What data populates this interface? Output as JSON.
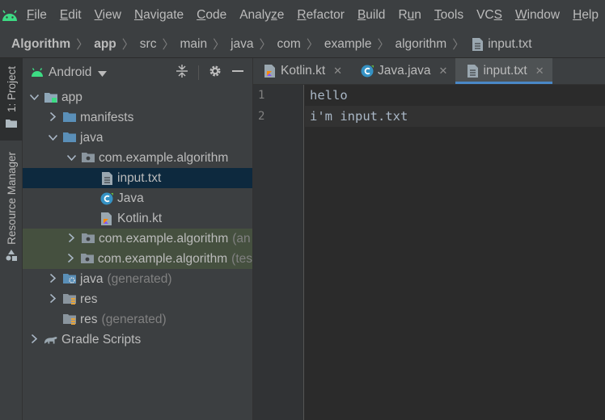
{
  "menu": {
    "items": [
      {
        "pre": "",
        "u": "F",
        "post": "ile"
      },
      {
        "pre": "",
        "u": "E",
        "post": "dit"
      },
      {
        "pre": "",
        "u": "V",
        "post": "iew"
      },
      {
        "pre": "",
        "u": "N",
        "post": "avigate"
      },
      {
        "pre": "",
        "u": "C",
        "post": "ode"
      },
      {
        "pre": "Analy",
        "u": "z",
        "post": "e"
      },
      {
        "pre": "",
        "u": "R",
        "post": "efactor"
      },
      {
        "pre": "",
        "u": "B",
        "post": "uild"
      },
      {
        "pre": "R",
        "u": "u",
        "post": "n"
      },
      {
        "pre": "",
        "u": "T",
        "post": "ools"
      },
      {
        "pre": "VC",
        "u": "S",
        "post": ""
      },
      {
        "pre": "",
        "u": "W",
        "post": "indow"
      },
      {
        "pre": "",
        "u": "H",
        "post": "elp"
      }
    ]
  },
  "breadcrumb": [
    "Algorithm",
    "app",
    "src",
    "main",
    "java",
    "com",
    "example",
    "algorithm",
    "input.txt"
  ],
  "toolstrip": {
    "project_tab": "1: Project",
    "resource_tab": "Resource Manager"
  },
  "project": {
    "view": "Android",
    "tree": [
      {
        "label": "app",
        "muted": "",
        "arrow": "down",
        "icon": "module-folder-icon",
        "depth": 0,
        "state": ""
      },
      {
        "label": "manifests",
        "muted": "",
        "arrow": "right",
        "icon": "folder-icon",
        "depth": 1,
        "state": ""
      },
      {
        "label": "java",
        "muted": "",
        "arrow": "down",
        "icon": "folder-icon",
        "depth": 1,
        "state": ""
      },
      {
        "label": "com.example.algorithm",
        "muted": "",
        "arrow": "down",
        "icon": "package-icon",
        "depth": 2,
        "state": ""
      },
      {
        "label": "input.txt",
        "muted": "",
        "arrow": "",
        "icon": "text-file-icon",
        "depth": 3,
        "state": "selected"
      },
      {
        "label": "Java",
        "muted": "",
        "arrow": "",
        "icon": "java-class-icon",
        "depth": 3,
        "state": ""
      },
      {
        "label": "Kotlin.kt",
        "muted": "",
        "arrow": "",
        "icon": "kotlin-file-icon",
        "depth": 3,
        "state": ""
      },
      {
        "label": "com.example.algorithm",
        "muted": "(an",
        "arrow": "right",
        "icon": "package-icon",
        "depth": 2,
        "state": "test"
      },
      {
        "label": "com.example.algorithm",
        "muted": "(tes",
        "arrow": "right",
        "icon": "package-icon",
        "depth": 2,
        "state": "test"
      },
      {
        "label": "java",
        "muted": "(generated)",
        "arrow": "right",
        "icon": "generated-folder-icon",
        "depth": 1,
        "state": ""
      },
      {
        "label": "res",
        "muted": "",
        "arrow": "right",
        "icon": "resource-folder-icon",
        "depth": 1,
        "state": ""
      },
      {
        "label": "res",
        "muted": "(generated)",
        "arrow": "",
        "icon": "resource-folder-icon",
        "depth": 1,
        "state": ""
      },
      {
        "label": "Gradle Scripts",
        "muted": "",
        "arrow": "right",
        "icon": "gradle-icon",
        "depth": 0,
        "state": ""
      }
    ]
  },
  "editor": {
    "tabs": [
      {
        "label": "Kotlin.kt",
        "icon": "kotlin-file-icon",
        "active": false
      },
      {
        "label": "Java.java",
        "icon": "java-class-icon",
        "active": false
      },
      {
        "label": "input.txt",
        "icon": "text-file-icon",
        "active": true
      }
    ],
    "lines": [
      "hello",
      "i'm input.txt"
    ]
  },
  "colors": {
    "accent": "#4a88c7",
    "selection": "#0d293e",
    "test_bg": "#45503f",
    "android_green": "#3ddc84"
  }
}
